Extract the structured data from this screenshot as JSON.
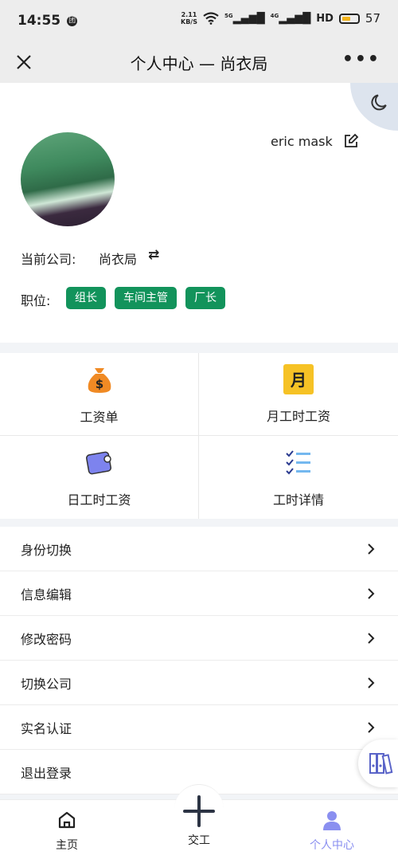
{
  "status_bar": {
    "time": "14:55",
    "notif": "团",
    "net_speed_top": "2.11",
    "net_speed_bottom": "KB/S",
    "sig1": "5G",
    "sig2": "4G",
    "hd": "HD",
    "battery": "57"
  },
  "nav": {
    "title": "个人中心 — 尚衣局",
    "close_icon": "close-icon",
    "more_icon": "more-icon",
    "more": "•••"
  },
  "profile": {
    "user_name": "eric mask",
    "company_label": "当前公司:",
    "company_value": "尚衣局",
    "role_label": "职位:",
    "roles": [
      "组长",
      "车间主管",
      "厂长"
    ]
  },
  "grid": [
    {
      "label": "工资单",
      "icon": "money-bag-icon"
    },
    {
      "label": "月工时工资",
      "icon": "month-calendar-icon",
      "icon_text": "月"
    },
    {
      "label": "日工时工资",
      "icon": "wallet-icon"
    },
    {
      "label": "工时详情",
      "icon": "checklist-icon"
    }
  ],
  "menu": [
    {
      "label": "身份切换"
    },
    {
      "label": "信息编辑"
    },
    {
      "label": "修改密码"
    },
    {
      "label": "切换公司"
    },
    {
      "label": "实名认证"
    },
    {
      "label": "退出登录"
    }
  ],
  "tabbar": {
    "home": "主页",
    "submit": "交工",
    "me": "个人中心"
  },
  "colors": {
    "accent_green": "#12935b",
    "active_tab": "#8a8ff0"
  }
}
